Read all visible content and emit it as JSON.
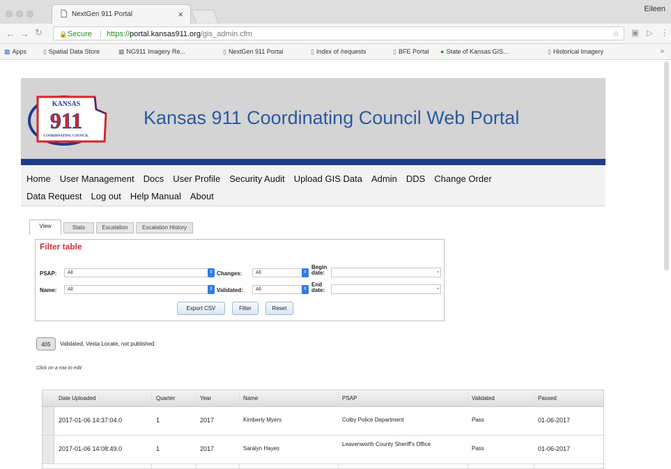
{
  "browser": {
    "tab_title": "NextGen 911 Portal",
    "user_name": "Eileen",
    "secure_label": "Secure",
    "url_protocol": "https://",
    "url_host": "portal.kansas911.org",
    "url_path": "/gis_admin.cfm",
    "bookmarks": [
      "Apps",
      "Spatial Data Store",
      "NG911 Imagery Re...",
      "NextGen 911 Portal",
      "Index of /requests",
      "BFE Portal",
      "State of Kansas GIS...",
      "Historical Imagery"
    ]
  },
  "header": {
    "logo_top": "KANSAS",
    "logo_number": "911",
    "logo_bottom": "COORDINATING COUNCIL",
    "title": "Kansas 911 Coordinating Council Web Portal"
  },
  "menu": {
    "row1": [
      "Home",
      "User Management",
      "Docs",
      "User Profile",
      "Security Audit",
      "Upload GIS Data",
      "Admin",
      "DDS",
      "Change Order"
    ],
    "row2": [
      "Data Request",
      "Log out",
      "Help Manual",
      "About"
    ]
  },
  "tabs": [
    "View",
    "Stats",
    "Escalation",
    "Escalation History"
  ],
  "filter": {
    "title": "Filter table",
    "psap_label": "PSAP:",
    "psap_value": "All",
    "name_label": "Name:",
    "name_value": "All",
    "changes_label": "Changes:",
    "changes_value": "All",
    "validated_label": "Validated:",
    "validated_value": "All",
    "begin_label_1": "Begin",
    "begin_label_2": "date:",
    "end_label_1": "End",
    "end_label_2": "date:",
    "export_button": "Export CSV",
    "filter_button": "Filter",
    "reset_button": "Reset"
  },
  "status": {
    "count": "405",
    "text": "Validated, Vesta Locate, not published"
  },
  "hint": "Click on a row to edit",
  "table": {
    "columns": [
      "Date Uploaded",
      "Quarter",
      "Year",
      "Name",
      "PSAP",
      "Validated",
      "Passed"
    ],
    "rows": [
      [
        "2017-01-06 14:37:04.0",
        "1",
        "2017",
        "Kimberly Myers",
        "Colby Police Department",
        "Pass",
        "01-06-2017"
      ],
      [
        "2017-01-06 14:08:49.0",
        "1",
        "2017",
        "Saralyn Hayes",
        "Leavenworth County Sheriff's Office",
        "Pass",
        "01-06-2017"
      ]
    ]
  },
  "colors": {
    "title_blue": "#2a5aa0",
    "stripe_navy": "#1f3c88",
    "filter_title_red": "#cc3333",
    "logo_red": "#d6262b",
    "logo_navy": "#1f3c88"
  }
}
